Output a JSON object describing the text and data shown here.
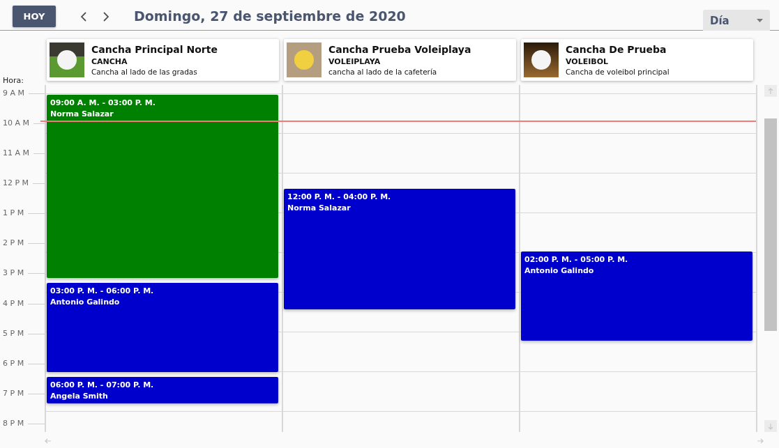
{
  "toolbar": {
    "today_button": "HOY",
    "title": "Domingo, 27 de septiembre de 2020",
    "view_select": {
      "value": "Día"
    }
  },
  "hour_label": "Hora:",
  "resources": [
    {
      "kind": "soccer",
      "name": "Cancha Principal Norte",
      "type": "CANCHA",
      "description": "Cancha al lado de las gradas",
      "events": [
        {
          "time": "09:00 A. M. - 03:00 P. M.",
          "person": "Norma Salazar",
          "color": "#008000"
        },
        {
          "time": "03:00 P. M. - 06:00 P. M.",
          "person": "Antonio Galindo",
          "color": "#0000cc"
        },
        {
          "time": "06:00 P. M. - 07:00 P. M.",
          "person": "Angela Smith",
          "color": "#0000cc"
        }
      ]
    },
    {
      "kind": "beach",
      "name": "Cancha Prueba Voleiplaya",
      "type": "VOLEIPLAYA",
      "description": "cancha al lado de la cafetería",
      "events": [
        {
          "time": "12:00 P. M. - 04:00 P. M.",
          "person": "Norma Salazar",
          "color": "#0000cc"
        }
      ]
    },
    {
      "kind": "volley",
      "name": "Cancha De Prueba",
      "type": "VOLEIBOL",
      "description": "Cancha de voleibol principal",
      "events": [
        {
          "time": "02:00 P. M. - 05:00 P. M.",
          "person": "Antonio Galindo",
          "color": "#0000cc"
        }
      ]
    }
  ],
  "hours": [
    "9 A M",
    "10 A M",
    "11 A M",
    "12 P M",
    "1 P M",
    "2 P M",
    "3 P M",
    "4 P M",
    "5 P M",
    "6 P M",
    "7 P M",
    "8 P M"
  ]
}
